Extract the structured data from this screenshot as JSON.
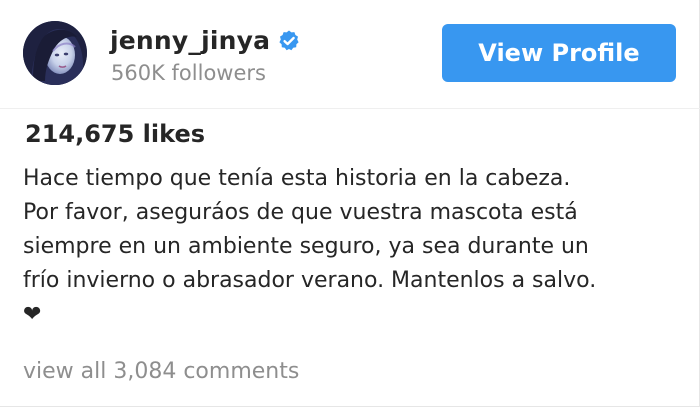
{
  "post": {
    "author": {
      "username": "jenny_jinya",
      "verified": true,
      "followers": "560K followers",
      "avatar_icon": "profile-avatar"
    },
    "view_profile_label": "View Profile",
    "likes": "214,675 likes",
    "caption_lines": [
      "Hace tiempo que tenía esta historia en la cabeza.",
      "Por favor, aseguráos de que vuestra mascota está",
      "siempre en un ambiente seguro, ya sea durante un",
      "frío invierno o abrasador verano. Mantenlos a salvo.",
      "❤"
    ],
    "comments_link": "view all 3,084 comments"
  },
  "colors": {
    "accent": "#3897f0",
    "text_primary": "#262626",
    "text_secondary": "#8e8e8e"
  }
}
